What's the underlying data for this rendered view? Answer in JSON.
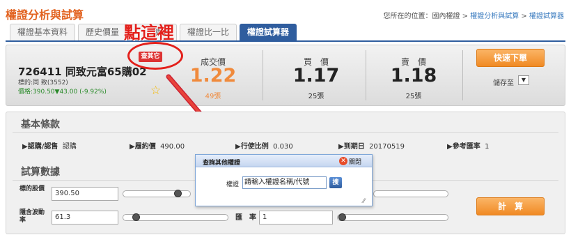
{
  "page": {
    "title": "權證分析與試算"
  },
  "breadcrumb": {
    "prefix": "您所在的位置：國內權證 >",
    "item1": "權證分析與試算",
    "sep": " > ",
    "item2": "權證試算器"
  },
  "tabs": [
    {
      "label": "權證基本資料"
    },
    {
      "label": "歷史價量"
    },
    {
      "label": "動率"
    },
    {
      "label": "權證比一比"
    },
    {
      "label": "權證試算器",
      "active": true
    }
  ],
  "annotation": {
    "click_here": "點這裡"
  },
  "quote": {
    "code_name": "726411 同致元富65購02",
    "underlying": "標的:同 致(3552)",
    "price_line": "價格:390.50▼43.00 (-9.92%)",
    "other_tag": "查其它",
    "last": {
      "label": "成交價",
      "price": "1.22",
      "volume": "49張"
    },
    "bid": {
      "label": "買　價",
      "price": "1.17",
      "volume": "25張"
    },
    "ask": {
      "label": "賣　價",
      "price": "1.18",
      "volume": "25張"
    },
    "quick_order": "快速下單",
    "save_to": "儲存至",
    "save_select": "▼"
  },
  "basic_terms": {
    "heading": "基本條款",
    "type_label": "▶認購/認售",
    "type_value": "認購",
    "strike_label": "▶履約價",
    "strike_value": "490.00",
    "ratio_label": "▶行使比例",
    "ratio_value": "0.030",
    "expiry_label": "▶到期日",
    "expiry_value": "20170519",
    "ref_rate_label": "▶參考匯率",
    "ref_rate_value": "1"
  },
  "calc": {
    "heading": "試算數據",
    "underlying_price_label": "標的股價",
    "underlying_price_value": "390.50",
    "implied_vol_label": "隱含波動率",
    "implied_vol_value": "61.3",
    "fx_label": "匯　率",
    "fx_value": "1",
    "calc_button": "計　算"
  },
  "modal": {
    "title": "查詢其他權證",
    "close": "關閉",
    "field_label": "權證",
    "placeholder": "請輸入權證名稱/代號",
    "search": "搜"
  },
  "colors": {
    "accent_orange": "#e2621f",
    "tab_blue": "#2f5d9e",
    "alert_red": "#e3201b",
    "up_price": "#f08a3c"
  }
}
